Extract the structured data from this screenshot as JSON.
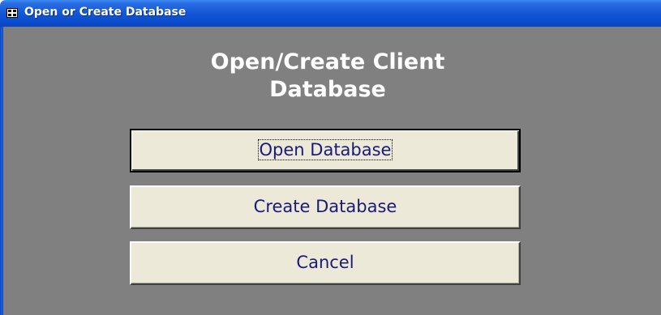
{
  "window": {
    "title": "Open or Create Database",
    "icon": "form-icon"
  },
  "form": {
    "heading_line1": "Open/Create Client",
    "heading_line2": "Database",
    "buttons": [
      {
        "label": "Open Database",
        "default": true
      },
      {
        "label": "Create Database",
        "default": false
      },
      {
        "label": "Cancel",
        "default": false
      }
    ]
  },
  "colors": {
    "titlebar": "#0b4fd0",
    "client_background": "#808080",
    "heading_text": "#ffffff",
    "button_face": "#ece9d8",
    "button_text": "#1a1a78"
  }
}
